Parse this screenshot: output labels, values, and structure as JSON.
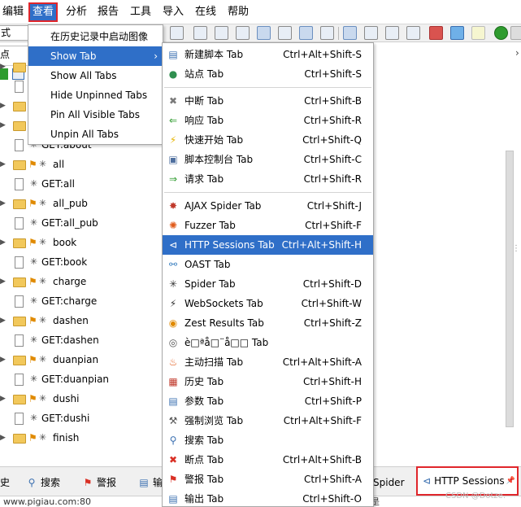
{
  "menubar": {
    "items": [
      "编辑",
      "查看",
      "分析",
      "报告",
      "工具",
      "导入",
      "在线",
      "帮助"
    ]
  },
  "toolbar": {
    "mode_text": "式"
  },
  "left_panel": {
    "tab_label": "点",
    "tree": [
      {
        "label": "",
        "type": "folder",
        "flag": false
      },
      {
        "label": "",
        "type": "doc",
        "flag": false
      },
      {
        "label": "",
        "type": "folder",
        "flag": false
      },
      {
        "label": "",
        "type": "folder",
        "flag": false
      },
      {
        "label": "GET:about",
        "type": "doc",
        "flag": false
      },
      {
        "label": "all",
        "type": "folder",
        "flag": true
      },
      {
        "label": "GET:all",
        "type": "doc",
        "flag": false
      },
      {
        "label": "all_pub",
        "type": "folder",
        "flag": true
      },
      {
        "label": "GET:all_pub",
        "type": "doc",
        "flag": false
      },
      {
        "label": "book",
        "type": "folder",
        "flag": true
      },
      {
        "label": "GET:book",
        "type": "doc",
        "flag": false
      },
      {
        "label": "charge",
        "type": "folder",
        "flag": true
      },
      {
        "label": "GET:charge",
        "type": "doc",
        "flag": false
      },
      {
        "label": "dashen",
        "type": "folder",
        "flag": true
      },
      {
        "label": "GET:dashen",
        "type": "doc",
        "flag": false
      },
      {
        "label": "duanpian",
        "type": "folder",
        "flag": true
      },
      {
        "label": "GET:duanpian",
        "type": "doc",
        "flag": false
      },
      {
        "label": "dushi",
        "type": "folder",
        "flag": true
      },
      {
        "label": "GET:dushi",
        "type": "doc",
        "flag": false
      },
      {
        "label": "finish",
        "type": "folder",
        "flag": true
      }
    ]
  },
  "view_menu": {
    "items": [
      {
        "label": "在历史记录中启动图像",
        "submenu": false
      },
      {
        "label": "Show Tab",
        "submenu": true
      },
      {
        "label": "Show All Tabs",
        "submenu": false
      },
      {
        "label": "Hide Unpinned Tabs",
        "submenu": false
      },
      {
        "label": "Pin All Visible Tabs",
        "submenu": false
      },
      {
        "label": "Unpin All Tabs",
        "submenu": false
      }
    ],
    "submenu_arrow": "›"
  },
  "show_tab_submenu": {
    "items": [
      {
        "label": "新建脚本 Tab",
        "shortcut": "Ctrl+Alt+Shift-S",
        "icon": "script-icon",
        "glyph": "▤",
        "color": "#3a6fb0"
      },
      {
        "label": "站点 Tab",
        "shortcut": "Ctrl+Shift-S",
        "icon": "globe-icon",
        "glyph": "●",
        "color": "#2f8f4f"
      },
      {
        "label": "中断 Tab",
        "shortcut": "Ctrl+Shift-B",
        "icon": "break-icon",
        "glyph": "✖",
        "color": "#7a7a7a"
      },
      {
        "label": "响应 Tab",
        "shortcut": "Ctrl+Shift-R",
        "icon": "response-arrow-icon",
        "glyph": "⇐",
        "color": "#2e9b2e"
      },
      {
        "label": "快速开始 Tab",
        "shortcut": "Ctrl+Shift-Q",
        "icon": "lightning-icon",
        "glyph": "⚡",
        "color": "#e6b400"
      },
      {
        "label": "脚本控制台 Tab",
        "shortcut": "Ctrl+Shift-C",
        "icon": "console-icon",
        "glyph": "▣",
        "color": "#4f6f9f"
      },
      {
        "label": "请求 Tab",
        "shortcut": "Ctrl+Shift-R",
        "icon": "request-arrow-icon",
        "glyph": "⇒",
        "color": "#2e9b2e"
      },
      {
        "label": "AJAX Spider Tab",
        "shortcut": "Ctrl+Shift-J",
        "icon": "ajax-spider-icon",
        "glyph": "✸",
        "color": "#c0392b"
      },
      {
        "label": "Fuzzer Tab",
        "shortcut": "Ctrl+Shift-F",
        "icon": "fuzzer-icon",
        "glyph": "✺",
        "color": "#e05a1a"
      },
      {
        "label": "HTTP Sessions Tab",
        "shortcut": "Ctrl+Alt+Shift-H",
        "icon": "http-sessions-icon",
        "glyph": "⊲",
        "color": "#ffffff"
      },
      {
        "label": "OAST Tab",
        "shortcut": "",
        "icon": "oast-icon",
        "glyph": "⚯",
        "color": "#3a7fc0"
      },
      {
        "label": "Spider Tab",
        "shortcut": "Ctrl+Shift-D",
        "icon": "spider-icon",
        "glyph": "✳",
        "color": "#333333"
      },
      {
        "label": "WebSockets Tab",
        "shortcut": "Ctrl+Shift-W",
        "icon": "websocket-plug-icon",
        "glyph": "⚡",
        "color": "#333333"
      },
      {
        "label": "Zest Results Tab",
        "shortcut": "Ctrl+Shift-Z",
        "icon": "zest-icon",
        "glyph": "◉",
        "color": "#e08a00"
      },
      {
        "label": "è□ªå□¨å□□ Tab",
        "shortcut": "",
        "icon": "unknown-tab-icon",
        "glyph": "◎",
        "color": "#555555"
      },
      {
        "label": "主动扫描 Tab",
        "shortcut": "Ctrl+Alt+Shift-A",
        "icon": "active-scan-flame-icon",
        "glyph": "♨",
        "color": "#e05a1a"
      },
      {
        "label": "历史 Tab",
        "shortcut": "Ctrl+Shift-H",
        "icon": "history-calendar-icon",
        "glyph": "▦",
        "color": "#c0392b"
      },
      {
        "label": "参数 Tab",
        "shortcut": "Ctrl+Shift-P",
        "icon": "params-icon",
        "glyph": "▤",
        "color": "#3a6fb0"
      },
      {
        "label": "强制浏览 Tab",
        "shortcut": "Ctrl+Alt+Shift-F",
        "icon": "hammer-icon",
        "glyph": "⚒",
        "color": "#555555"
      },
      {
        "label": "搜索 Tab",
        "shortcut": "",
        "icon": "search-icon",
        "glyph": "⚲",
        "color": "#3a6fb0"
      },
      {
        "label": "断点 Tab",
        "shortcut": "Ctrl+Alt+Shift-B",
        "icon": "breakpoint-x-icon",
        "glyph": "✖",
        "color": "#d93025"
      },
      {
        "label": "警报 Tab",
        "shortcut": "Ctrl+Shift-A",
        "icon": "alert-flag-icon",
        "glyph": "⚑",
        "color": "#d93025"
      },
      {
        "label": "输出 Tab",
        "shortcut": "Ctrl+Shift-O",
        "icon": "output-icon",
        "glyph": "▤",
        "color": "#3a6fb0"
      }
    ]
  },
  "bottom_tabs": [
    {
      "label": "史",
      "icon": ""
    },
    {
      "label": "搜索",
      "icon": "search-icon"
    },
    {
      "label": "警报",
      "icon": "alert-flag-icon"
    },
    {
      "label": "输",
      "icon": "output-icon"
    },
    {
      "label": "Spider",
      "icon": ""
    }
  ],
  "active_bottom_tab": {
    "label": "HTTP Sessions",
    "pin": "📌"
  },
  "status_bar": {
    "text": "www.pigiau.com:80",
    "right_text": "是"
  },
  "watermark": "CSDN @Dotze.",
  "colors": {
    "accent": "#2f6fc8",
    "highlight_border": "#e0262b"
  }
}
